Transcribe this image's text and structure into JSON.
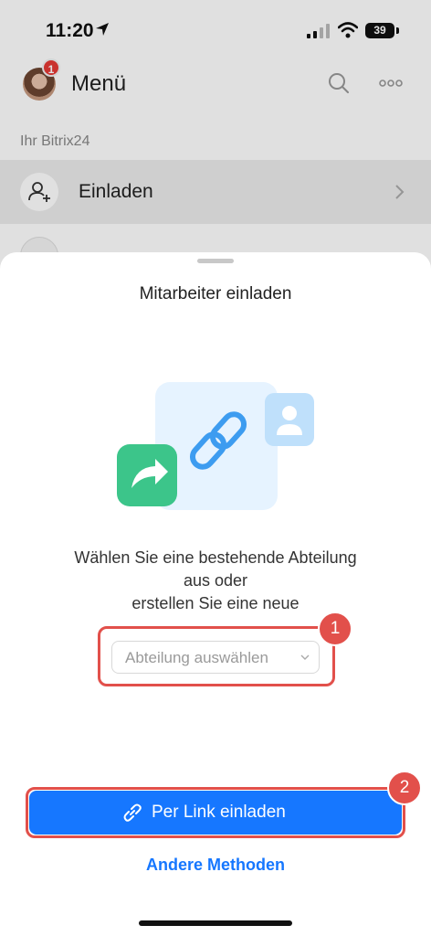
{
  "status_bar": {
    "time": "11:20",
    "battery": "39"
  },
  "header": {
    "title": "Menü",
    "avatar_badge": "1"
  },
  "menu": {
    "section_title": "Ihr Bitrix24",
    "items": [
      {
        "label": "Einladen"
      }
    ]
  },
  "sheet": {
    "title": "Mitarbeiter einladen",
    "description_lines": [
      "Wählen Sie eine bestehende Abteilung",
      "aus oder",
      "erstellen Sie eine neue"
    ],
    "department_select_placeholder": "Abteilung auswählen",
    "primary_button_label": "Per Link einladen",
    "secondary_link_label": "Andere Methoden"
  },
  "annotations": {
    "marker1": "1",
    "marker2": "2"
  },
  "colors": {
    "accent": "#1677ff",
    "highlight": "#e2504b",
    "green": "#3cc58a"
  }
}
